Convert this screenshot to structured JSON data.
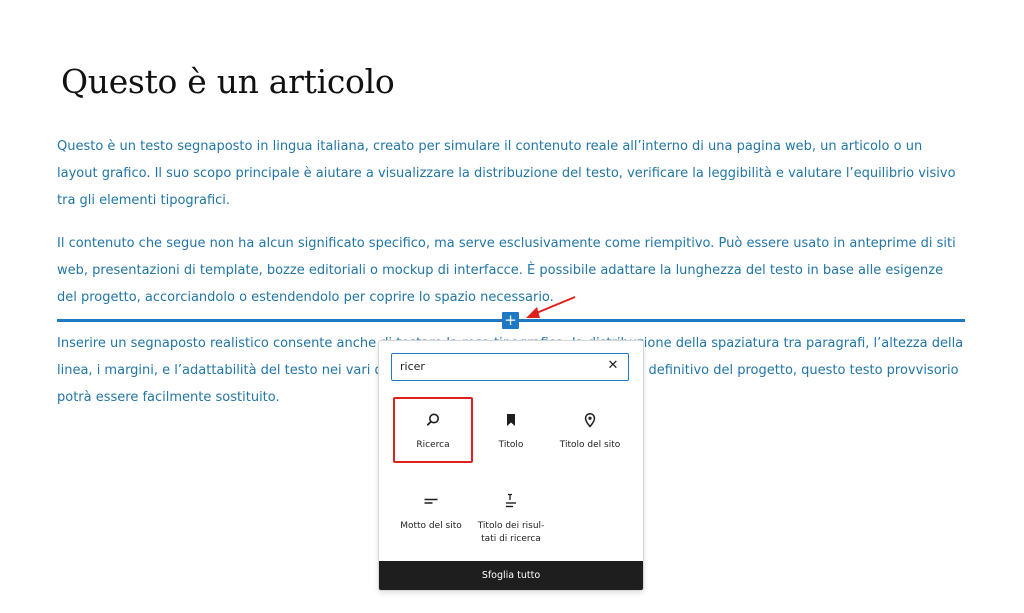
{
  "article": {
    "title": "Questo è un articolo",
    "paragraphs": [
      "Questo è un testo segnaposto in lingua italiana, creato per simulare il contenuto reale all’interno di una pagina web, un articolo o un layout grafico. Il suo scopo principale è aiutare a visualizzare la distribuzione del testo, verificare la leggibilità e valutare l’equilibrio visivo tra gli elementi tipografici.",
      "Il contenuto che segue non ha alcun significato specifico, ma serve esclusivamente come riempitivo. Può essere usato in anteprime di siti web, presentazioni di template, bozze editoriali o mockup di interfacce. È possibile adattare la lunghezza del testo in base alle esigenze del progetto, accorciandolo o estendendolo per coprire lo spazio necessario.",
      "Inserire un segnaposto realistico consente anche di testare la resa tipografica, la distribuzione della spaziatura tra paragrafi, l’altezza della linea, i margini, e l’adattabilità del testo nei vari dispositivi. Una volta inserito il contenuto definitivo del progetto, questo testo provvisorio potrà essere facilmente sostituito."
    ]
  },
  "inserter": {
    "plus_label": "+",
    "search": {
      "value": "ricer",
      "clear_label": "✕"
    },
    "blocks": [
      {
        "label": "Ricerca",
        "icon": "search-icon",
        "highlighted": true
      },
      {
        "label": "Titolo",
        "icon": "bookmark-icon"
      },
      {
        "label": "Titolo del sito",
        "icon": "map-marker-icon"
      },
      {
        "label": "Motto del sito",
        "icon": "text-lines-icon"
      },
      {
        "label": "Titolo dei risul-tati di ricerca",
        "icon": "title-text-icon"
      }
    ],
    "browse_all_label": "Sfoglia tutto"
  },
  "colors": {
    "link_text": "#2276a5",
    "accent": "#1e79c2",
    "highlight_box": "#e0201b",
    "browse_bar": "#1e1e1e"
  }
}
